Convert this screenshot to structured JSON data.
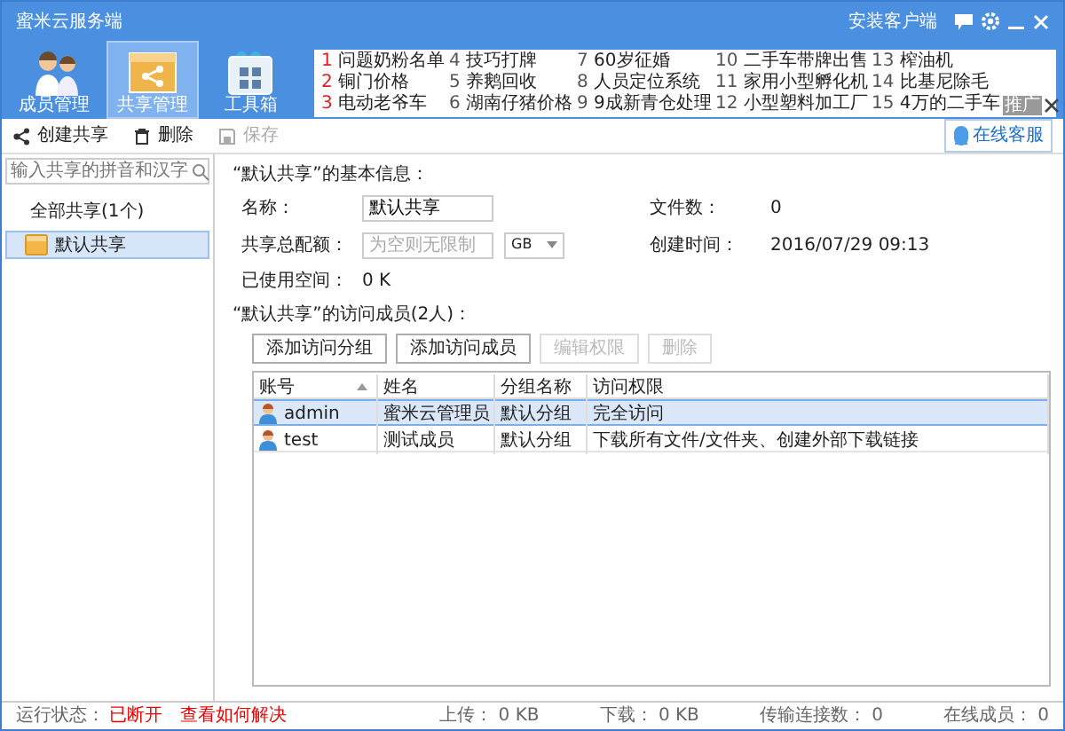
{
  "window": {
    "title": "蜜米云服务端",
    "client_link": "安装客户端"
  },
  "nav": [
    {
      "label": "成员管理",
      "selected": false,
      "kind": "members"
    },
    {
      "label": "共享管理",
      "selected": true,
      "kind": "share"
    },
    {
      "label": "工具箱",
      "selected": false,
      "kind": "toolbox"
    }
  ],
  "ads": {
    "tag": "推广",
    "items": [
      {
        "number": "1",
        "text": "问题奶粉名单",
        "hot": true
      },
      {
        "number": "2",
        "text": "铜门价格",
        "hot": true
      },
      {
        "number": "3",
        "text": "电动老爷车",
        "hot": true
      },
      {
        "number": "4",
        "text": "技巧打牌",
        "hot": false
      },
      {
        "number": "5",
        "text": "养鹅回收",
        "hot": false
      },
      {
        "number": "6",
        "text": "湖南仔猪价格",
        "hot": false
      },
      {
        "number": "7",
        "text": "60岁征婚",
        "hot": false
      },
      {
        "number": "8",
        "text": "人员定位系统",
        "hot": false
      },
      {
        "number": "9",
        "text": "9成新青仓处理",
        "hot": false
      },
      {
        "number": "10",
        "text": "二手车带牌出售",
        "hot": false
      },
      {
        "number": "11",
        "text": "家用小型孵化机",
        "hot": false
      },
      {
        "number": "12",
        "text": "小型塑料加工厂",
        "hot": false
      },
      {
        "number": "13",
        "text": "榨油机",
        "hot": false
      },
      {
        "number": "14",
        "text": "比基尼除毛",
        "hot": false
      },
      {
        "number": "15",
        "text": "4万的二手车",
        "hot": false
      }
    ]
  },
  "toolbar": [
    {
      "label": "创建共享",
      "kind": "share",
      "disabled": false
    },
    {
      "label": "删除",
      "kind": "trash",
      "disabled": false
    },
    {
      "label": "保存",
      "kind": "save",
      "disabled": true
    }
  ],
  "support_button": "在线客服",
  "sidebar": {
    "placeholder": "输入共享的拼音和汉字",
    "root": "全部共享(1个)",
    "items": [
      {
        "label": "默认共享",
        "selected": true
      }
    ]
  },
  "info": {
    "heading": "“默认共享”的基本信息：",
    "name_label": "名称：",
    "name_value": "默认共享",
    "quota_label": "共享总配额：",
    "quota_placeholder": "为空则无限制",
    "quota_unit": "GB",
    "used_label": "已使用空间：",
    "used_value": "0 K",
    "files_label": "文件数：",
    "files_value": "0",
    "created_label": "创建时间：",
    "created_value": "2016/07/29 09:13"
  },
  "members": {
    "heading": "“默认共享”的访问成员(2人)：",
    "buttons": [
      {
        "label": "添加访问分组",
        "disabled": false
      },
      {
        "label": "添加访问成员",
        "disabled": false
      },
      {
        "label": "编辑权限",
        "disabled": true
      },
      {
        "label": "删除",
        "disabled": true
      }
    ],
    "columns": [
      "账号",
      "姓名",
      "分组名称",
      "访问权限"
    ],
    "rows": [
      {
        "cells": [
          "admin",
          "蜜米云管理员",
          "默认分组",
          "完全访问"
        ],
        "selected": true
      },
      {
        "cells": [
          "test",
          "测试成员",
          "默认分组",
          "下载所有文件/文件夹、创建外部下载链接"
        ],
        "selected": false
      }
    ]
  },
  "status_bar": {
    "label": "运行状态：",
    "state": "已断开",
    "help_link": "查看如何解决",
    "stats": [
      {
        "label": "上传：",
        "value": "0 KB"
      },
      {
        "label": "下载：",
        "value": "0 KB"
      },
      {
        "label": "传输连接数：",
        "value": "0"
      },
      {
        "label": "在线成员：",
        "value": "0"
      }
    ]
  }
}
